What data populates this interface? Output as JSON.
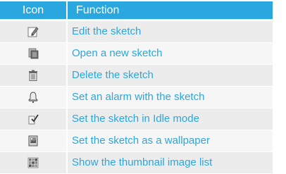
{
  "table": {
    "header": {
      "icon_col": "Icon",
      "function_col": "Function"
    },
    "rows": [
      {
        "icon": "edit-pencil-icon",
        "function": "Edit the sketch"
      },
      {
        "icon": "new-page-icon",
        "function": "Open a new sketch"
      },
      {
        "icon": "trash-can-icon",
        "function": "Delete the sketch"
      },
      {
        "icon": "alarm-bell-icon",
        "function": "Set an alarm with the sketch"
      },
      {
        "icon": "idle-mode-icon",
        "function": "Set the sketch in Idle mode"
      },
      {
        "icon": "wallpaper-icon",
        "function": "Set the sketch as a wallpaper"
      },
      {
        "icon": "thumbnail-grid-icon",
        "function": "Show the thumbnail image list"
      }
    ]
  },
  "colors": {
    "accent": "#2aa7df",
    "row_odd": "#ececec",
    "row_even": "#f6f6f6"
  }
}
